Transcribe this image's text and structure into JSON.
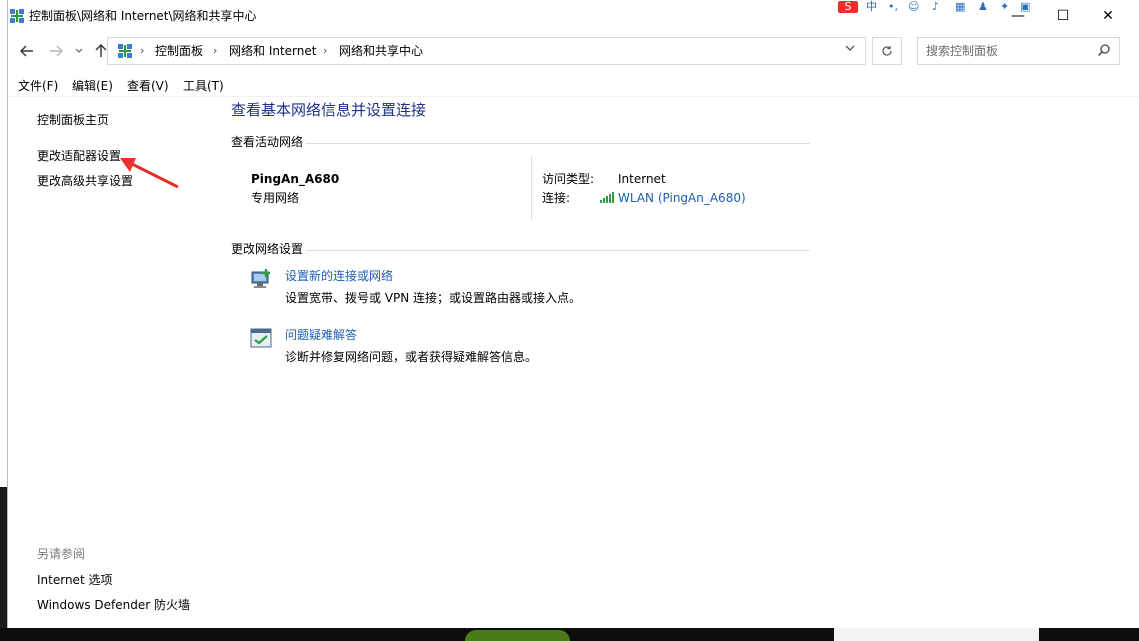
{
  "window": {
    "title": "控制面板\\网络和 Internet\\网络和共享中心",
    "controls": {
      "minimize": "—",
      "maximize": "☐",
      "close": "✕"
    }
  },
  "address_bar": {
    "breadcrumbs": [
      "控制面板",
      "网络和 Internet",
      "网络和共享中心"
    ],
    "separator": "›"
  },
  "search": {
    "placeholder": "搜索控制面板"
  },
  "menu": [
    "文件(F)",
    "编辑(E)",
    "查看(V)",
    "工具(T)"
  ],
  "left_pane": {
    "home": "控制面板主页",
    "links": [
      "更改适配器设置",
      "更改高级共享设置"
    ],
    "see_also_title": "另请参阅",
    "see_also": [
      "Internet 选项",
      "Windows Defender 防火墙"
    ]
  },
  "main": {
    "title": "查看基本网络信息并设置连接",
    "active_networks_heading": "查看活动网络",
    "network": {
      "name": "PingAn_A680",
      "category": "专用网络",
      "access_type_label": "访问类型:",
      "access_type_value": "Internet",
      "connection_label": "连接:",
      "connection_value": "WLAN (PingAn_A680)"
    },
    "change_settings_heading": "更改网络设置",
    "tasks": [
      {
        "title": "设置新的连接或网络",
        "desc": "设置宽带、拨号或 VPN 连接；或设置路由器或接入点。"
      },
      {
        "title": "问题疑难解答",
        "desc": "诊断并修复网络问题，或者获得疑难解答信息。"
      }
    ]
  },
  "tray": {
    "ime_label": "中"
  },
  "colors": {
    "link": "#1a5fb4",
    "title": "#1e3287",
    "annotation": "#e8322b"
  }
}
